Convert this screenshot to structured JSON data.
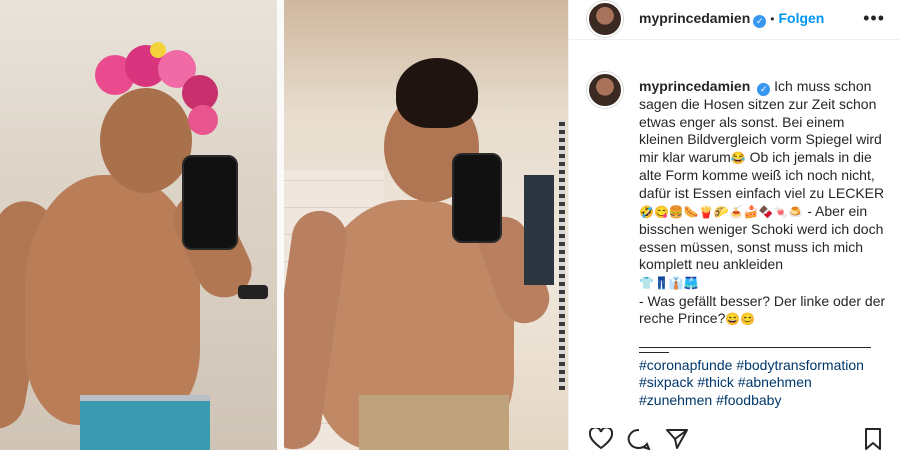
{
  "post": {
    "username": "myprincedamien",
    "follow_label": "Folgen",
    "separator": "•",
    "more_label": "•••",
    "verified_mark": "✓"
  },
  "caption": {
    "username": "myprincedamien",
    "text_1": "Ich muss schon sagen die Hosen sitzen zur Zeit schon etwas enger als sonst. Bei einem kleinen Bildvergleich vorm Spiegel wird mir klar warum",
    "emoji_1": "😂",
    "text_2": " Ob ich jemals in die alte Form komme weiß ich noch nicht, dafür ist Essen einfach viel zu LECKER",
    "emoji_2": "🤣😋🍔🌭🍟🌮🍝🍰🍫🍬🍮",
    "text_3": " - Aber ein bisschen weniger Schoki werd ich doch essen müssen, sonst muss ich mich komplett neu ankleiden",
    "emoji_3": "👕👖👔🩳",
    "text_4": "- Was gefällt besser? Der linke oder der reche Prince?",
    "emoji_4": "😄😊",
    "hashtags": [
      "#coronapfunde",
      "#bodytransformation",
      "#sixpack",
      "#thick",
      "#abnehmen",
      "#zunehmen",
      "#foodbaby"
    ]
  },
  "actions": {
    "like_icon": "heart-icon",
    "comment_icon": "comment-icon",
    "share_icon": "share-icon",
    "save_icon": "bookmark-icon"
  },
  "colors": {
    "link": "#0095f6",
    "verified": "#3897f0",
    "hashtag": "#00376b"
  }
}
